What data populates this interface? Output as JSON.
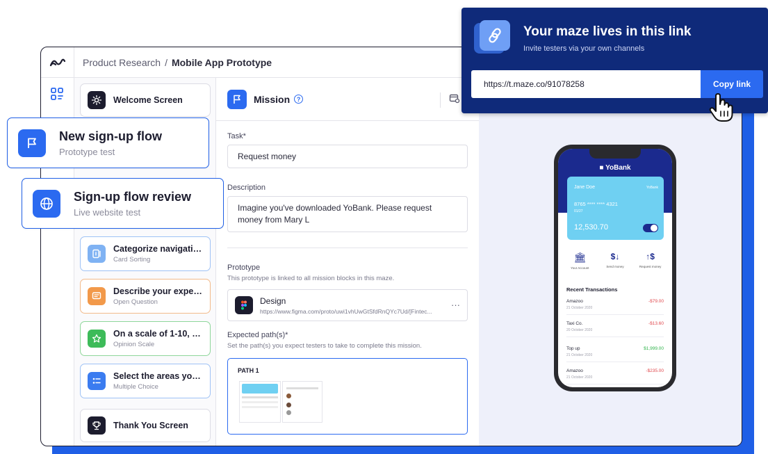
{
  "app": {
    "breadcrumb": {
      "parent": "Product Research",
      "current": "Mobile App Prototype"
    }
  },
  "blocks": [
    {
      "title": "Welcome Screen",
      "subtitle": "",
      "icon": "sun-icon"
    },
    {
      "title": "Categorize navigation...",
      "subtitle": "Card Sorting",
      "icon": "card-sorting-icon"
    },
    {
      "title": "Describe your experie...",
      "subtitle": "Open Question",
      "icon": "message-icon"
    },
    {
      "title": "On a scale of 1-10, rate...",
      "subtitle": "Opinion Scale",
      "icon": "star-icon"
    },
    {
      "title": "Select the areas you...",
      "subtitle": "Multiple Choice",
      "icon": "checklist-icon"
    },
    {
      "title": "Thank You Screen",
      "subtitle": "",
      "icon": "trophy-icon"
    }
  ],
  "floating_cards": [
    {
      "title": "New sign-up flow",
      "subtitle": "Prototype test",
      "icon": "flag-icon"
    },
    {
      "title": "Sign-up flow review",
      "subtitle": "Live website test",
      "icon": "globe-icon"
    }
  ],
  "mission": {
    "title": "Mission",
    "task_label": "Task*",
    "task_value": "Request money",
    "description_label": "Description",
    "description_value": "Imagine you've downloaded YoBank. Please request money from Mary L",
    "prototype_label": "Prototype",
    "prototype_hint": "This prototype is linked to all mission blocks in this maze.",
    "design_title": "Design",
    "design_url": "https://www.figma.com/proto/uwi1vhUwGtSfdRnQYc7Ud/[Fintec...",
    "paths_label": "Expected path(s)*",
    "paths_hint": "Set the path(s) you expect testers to take to complete this mission.",
    "path_name": "PATH 1"
  },
  "link_panel": {
    "title": "Your maze lives in this link",
    "subtitle": "Invite testers via your own channels",
    "url": "https://t.maze.co/91078258",
    "copy_label": "Copy link"
  },
  "phone": {
    "brand": "YoBank",
    "card_holder": "Jane Doe",
    "card_bank": "YoBank",
    "card_number": "8765 **** **** 4321",
    "card_expiry": "01/27",
    "balance": "12,530.70",
    "actions": [
      "Your Account",
      "Send money",
      "Request money"
    ],
    "transactions_title": "Recent Transactions",
    "transactions": [
      {
        "name": "Amazoo",
        "date": "21 October 2020",
        "amount": "-$79.00",
        "color": "#e0474c"
      },
      {
        "name": "Taxi Co.",
        "date": "20 October 2020",
        "amount": "-$13.60",
        "color": "#e0474c"
      },
      {
        "name": "Top up",
        "date": "21 October 2020",
        "amount": "$1,999.00",
        "color": "#2fb34a"
      },
      {
        "name": "Amazoo",
        "date": "21 October 2020",
        "amount": "-$235.00",
        "color": "#e0474c"
      }
    ]
  },
  "colors": {
    "accent": "#2b6af0",
    "panel": "#0f2a7a",
    "backdrop": "#1f5fe6"
  }
}
